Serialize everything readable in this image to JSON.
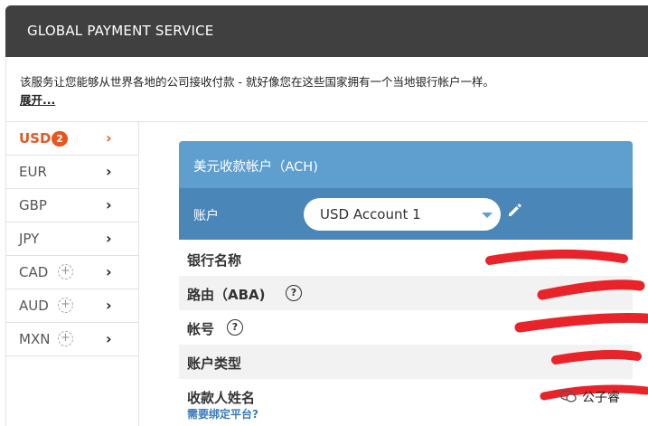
{
  "header": {
    "title": "GLOBAL PAYMENT SERVICE"
  },
  "description": {
    "text": "该服务让您能够从世界各地的公司接收付款 - 就好像您在这些国家拥有一个当地银行帐户一样。",
    "expand_link": "展开..."
  },
  "sidebar": {
    "items": [
      {
        "label": "USD",
        "badge": "2",
        "active": true
      },
      {
        "label": "EUR"
      },
      {
        "label": "GBP"
      },
      {
        "label": "JPY"
      },
      {
        "label": "CAD",
        "add_icon": "plus-circle"
      },
      {
        "label": "AUD",
        "add_icon": "plus-circle"
      },
      {
        "label": "MXN",
        "add_icon": "plus-circle"
      }
    ],
    "chevron": "›"
  },
  "panel": {
    "title": "美元收款帐户（ACH)",
    "account_label": "账户",
    "account_select": {
      "value": "USD Account 1"
    },
    "rows": [
      {
        "label": "银行名称"
      },
      {
        "label": "路由（ABA)",
        "help": "?"
      },
      {
        "label": "帐号",
        "help": "?"
      },
      {
        "label": "账户类型"
      },
      {
        "label": "收款人姓名",
        "link": "需要绑定平台?"
      }
    ]
  },
  "watermark": {
    "text": "公子睿"
  },
  "colors": {
    "header_bg": "#404040",
    "accent": "#e8561e",
    "panel_head": "#5e9fcf",
    "account_row": "#4a86b8",
    "link": "#3a7bbf",
    "redaction": "#e8232a"
  }
}
